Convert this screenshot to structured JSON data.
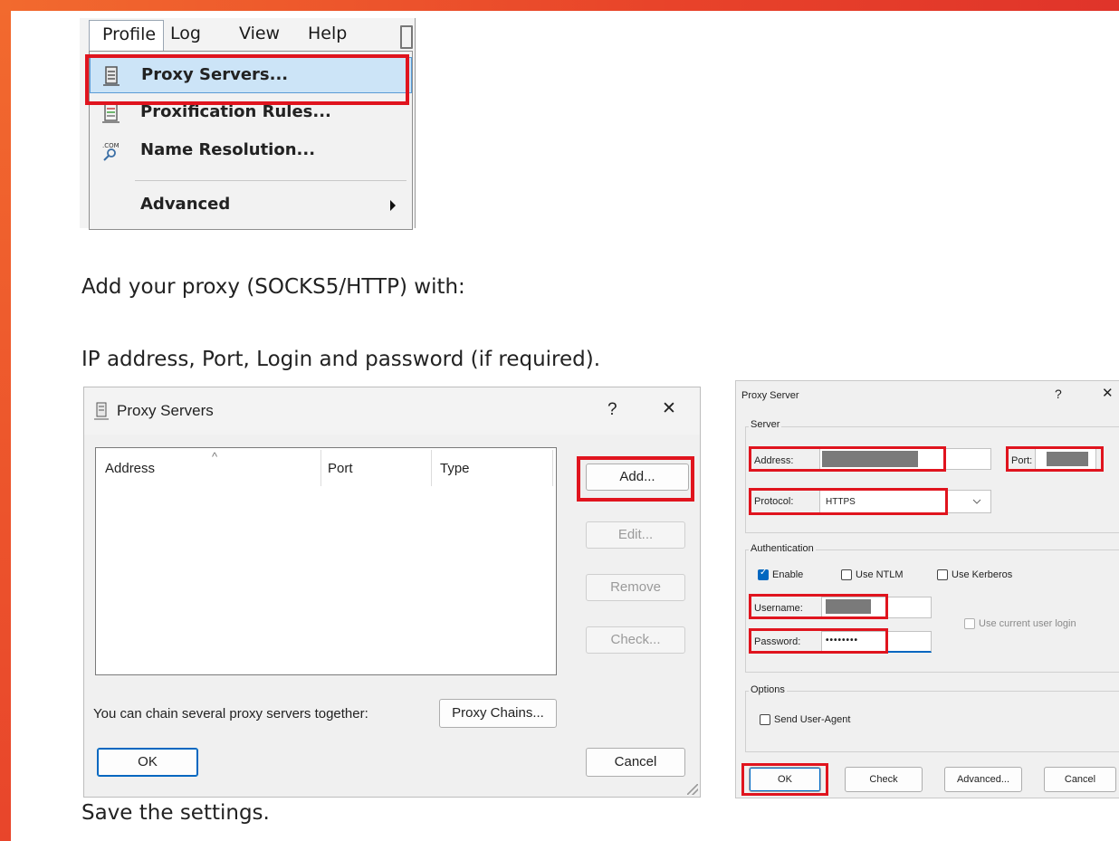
{
  "menu": {
    "bar": [
      "Profile",
      "Log",
      "View",
      "Help"
    ],
    "items": [
      {
        "label": "Proxy Servers...",
        "icon": "server-icon",
        "highlighted": true
      },
      {
        "label": "Proxification Rules...",
        "icon": "rules-icon"
      },
      {
        "label": "Name Resolution...",
        "icon": "dns-icon",
        "icon_text": ".COM"
      },
      {
        "label": "Advanced",
        "has_submenu": true
      }
    ]
  },
  "text": {
    "line1": "Add your proxy (SOCKS5/HTTP) with:",
    "line2": "IP address, Port, Login and password (if required).",
    "line3": "Save the settings."
  },
  "proxy_servers_dialog": {
    "title": "Proxy Servers",
    "help": "?",
    "close": "✕",
    "columns": [
      "Address",
      "Port",
      "Type"
    ],
    "sort_glyph": "^",
    "buttons": {
      "add": "Add...",
      "edit": "Edit...",
      "remove": "Remove",
      "check": "Check..."
    },
    "chain_text": "You can chain several proxy servers together:",
    "chains_button": "Proxy Chains...",
    "ok": "OK",
    "cancel": "Cancel"
  },
  "proxy_server_dialog": {
    "title": "Proxy Server",
    "help": "?",
    "close": "✕",
    "server_group": "Server",
    "address_label": "Address:",
    "port_label": "Port:",
    "protocol_label": "Protocol:",
    "protocol_value": "HTTPS",
    "auth_group": "Authentication",
    "enable_label": "Enable",
    "ntlm_label": "Use NTLM",
    "kerberos_label": "Use Kerberos",
    "username_label": "Username:",
    "password_label": "Password:",
    "password_mask": "••••••••",
    "current_user_label": "Use current user login",
    "options_group": "Options",
    "useragent_label": "Send User-Agent",
    "ok": "OK",
    "check": "Check",
    "advanced": "Advanced...",
    "cancel": "Cancel"
  },
  "colors": {
    "highlight": "#e0141e",
    "frame": "#e8432a",
    "menu_highlight": "#cce4f7"
  }
}
